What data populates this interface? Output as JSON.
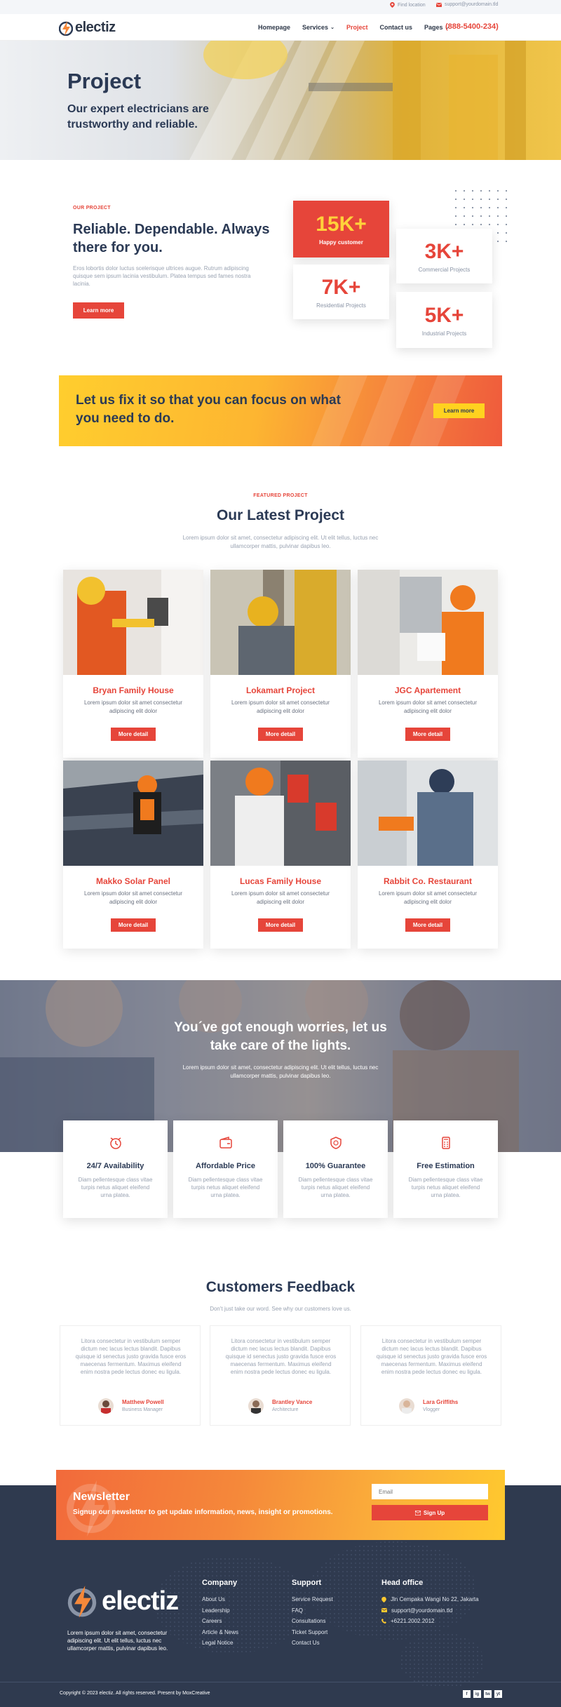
{
  "topbar": {
    "location": "Find location",
    "email": "support@yourdomain.tld"
  },
  "brand": {
    "name": "electiz"
  },
  "nav": {
    "items": [
      "Homepage",
      "Services",
      "Project",
      "Contact us",
      "Pages"
    ],
    "phone": "(888-5400-234)"
  },
  "hero": {
    "title": "Project",
    "subtitle": "Our expert electricians are trustworthy and reliable."
  },
  "about": {
    "eyebrow": "OUR PROJECT",
    "title": "Reliable. Dependable. Always there for you.",
    "text": "Eros lobortis dolor luctus scelerisque ultrices augue. Rutrum adipiscing quisque sem ipsum lacinia vestibulum. Platea tempus sed fames nostra lacinia.",
    "button": "Learn more",
    "stats": [
      {
        "value": "15K+",
        "label": "Happy customer"
      },
      {
        "value": "3K+",
        "label": "Commercial Projects"
      },
      {
        "value": "7K+",
        "label": "Residential Projects"
      },
      {
        "value": "5K+",
        "label": "Industrial Projects"
      }
    ]
  },
  "cta": {
    "text": "Let us fix it so that you can focus on what you need to do.",
    "button": "Learn more"
  },
  "projects": {
    "eyebrow": "FEATURED PROJECT",
    "title": "Our Latest Project",
    "text": "Lorem ipsum dolor sit amet, consectetur adipiscing elit. Ut elit tellus, luctus nec ullamcorper mattis, pulvinar dapibus leo.",
    "items": [
      {
        "title": "Bryan Family House",
        "text": "Lorem ipsum dolor sit amet consectetur adipiscing elit dolor",
        "button": "More detail"
      },
      {
        "title": "Lokamart Project",
        "text": "Lorem ipsum dolor sit amet consectetur adipiscing elit dolor",
        "button": "More detail"
      },
      {
        "title": "JGC Apartement",
        "text": "Lorem ipsum dolor sit amet consectetur adipiscing elit dolor",
        "button": "More detail"
      },
      {
        "title": "Makko Solar Panel",
        "text": "Lorem ipsum dolor sit amet consectetur adipiscing elit dolor",
        "button": "More detail"
      },
      {
        "title": "Lucas Family House",
        "text": "Lorem ipsum dolor sit amet consectetur adipiscing elit dolor",
        "button": "More detail"
      },
      {
        "title": "Rabbit Co. Restaurant",
        "text": "Lorem ipsum dolor sit amet consectetur adipiscing elit dolor",
        "button": "More detail"
      }
    ]
  },
  "care": {
    "title": "You´ve got enough worries, let us take care of the lights.",
    "text": "Lorem ipsum dolor sit amet, consectetur adipiscing elit. Ut elit tellus, luctus nec ullamcorper mattis, pulvinar dapibus leo.",
    "features": [
      {
        "title": "24/7 Availability",
        "text": "Diam pellentesque class vitae turpis netus aliquet eleifend urna platea."
      },
      {
        "title": "Affordable Price",
        "text": "Diam pellentesque class vitae turpis netus aliquet eleifend urna platea."
      },
      {
        "title": "100% Guarantee",
        "text": "Diam pellentesque class vitae turpis netus aliquet eleifend urna platea."
      },
      {
        "title": "Free Estimation",
        "text": "Diam pellentesque class vitae turpis netus aliquet eleifend urna platea."
      }
    ]
  },
  "feedback": {
    "title": "Customers Feedback",
    "subtitle": "Don't just take our word. See why our customers love us.",
    "items": [
      {
        "text": "Litora consectetur in vestibulum semper dictum nec lacus lectus blandit. Dapibus quisque id senectus justo gravida fusce eros maecenas fermentum. Maximus eleifend enim nostra pede lectus donec eu ligula.",
        "name": "Matthew Powell",
        "role": "Business Manager"
      },
      {
        "text": "Litora consectetur in vestibulum semper dictum nec lacus lectus blandit. Dapibus quisque id senectus justo gravida fusce eros maecenas fermentum. Maximus eleifend enim nostra pede lectus donec eu ligula.",
        "name": "Brantley Vance",
        "role": "Architecture"
      },
      {
        "text": "Litora consectetur in vestibulum semper dictum nec lacus lectus blandit. Dapibus quisque id senectus justo gravida fusce eros maecenas fermentum. Maximus eleifend enim nostra pede lectus donec eu ligula.",
        "name": "Lara Griffiths",
        "role": "Vlogger"
      }
    ]
  },
  "newsletter": {
    "title": "Newsletter",
    "text": "Signup our newsletter to get update information, news, insight or promotions.",
    "placeholder": "Email",
    "button": "Sign Up"
  },
  "footer": {
    "about": "Lorem ipsum dolor sit amet, consectetur adipiscing elit. Ut elit tellus, luctus nec ullamcorper mattis, pulvinar dapibus leo.",
    "company": {
      "title": "Company",
      "links": [
        "About Us",
        "Leadership",
        "Careers",
        "Article & News",
        "Legal Notice"
      ]
    },
    "support": {
      "title": "Support",
      "links": [
        "Service Request",
        "FAQ",
        "Consultations",
        "Ticket Support",
        "Contact Us"
      ]
    },
    "head": {
      "title": "Head office",
      "address": "Jln Cempaka Wangi No 22, Jakarta",
      "email": "support@yourdomain.tld",
      "phone": "+6221.2002.2012"
    },
    "copyright": "Copyright © 2023 electiz. All rights reserved. Present by MoxCreative",
    "social": [
      "f",
      "ig",
      "tw",
      "yt"
    ]
  },
  "colors": {
    "accent": "#e6453a",
    "navy": "#2b3a55",
    "footer": "#2f3a4f",
    "yellow": "#ffce2e"
  }
}
